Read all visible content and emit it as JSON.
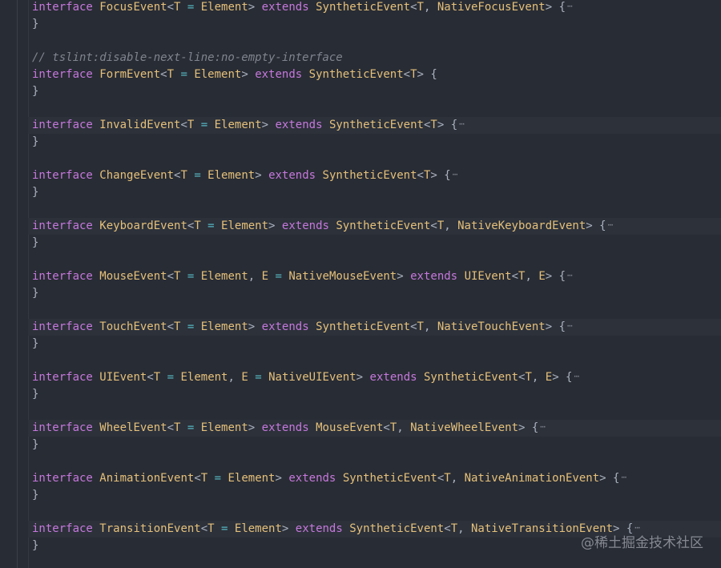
{
  "editor": {
    "comment": "// tslint:disable-next-line:no-empty-interface",
    "fold_marker": "⋯",
    "close_brace": "}",
    "lines": [
      {
        "kw": "interface",
        "name": "FocusEvent",
        "generic": "<T = Element>",
        "extends": "extends",
        "base": "SyntheticEvent<T, NativeFocusEvent>",
        "folded": true
      },
      {
        "kw": "interface",
        "name": "FormEvent",
        "generic": "<T = Element>",
        "extends": "extends",
        "base": "SyntheticEvent<T>",
        "folded": false
      },
      {
        "kw": "interface",
        "name": "InvalidEvent",
        "generic": "<T = Element>",
        "extends": "extends",
        "base": "SyntheticEvent<T>",
        "folded": true
      },
      {
        "kw": "interface",
        "name": "ChangeEvent",
        "generic": "<T = Element>",
        "extends": "extends",
        "base": "SyntheticEvent<T>",
        "folded": true
      },
      {
        "kw": "interface",
        "name": "KeyboardEvent",
        "generic": "<T = Element>",
        "extends": "extends",
        "base": "SyntheticEvent<T, NativeKeyboardEvent>",
        "folded": true
      },
      {
        "kw": "interface",
        "name": "MouseEvent",
        "generic": "<T = Element, E = NativeMouseEvent>",
        "extends": "extends",
        "base": "UIEvent<T, E>",
        "folded": true
      },
      {
        "kw": "interface",
        "name": "TouchEvent",
        "generic": "<T = Element>",
        "extends": "extends",
        "base": "SyntheticEvent<T, NativeTouchEvent>",
        "folded": true
      },
      {
        "kw": "interface",
        "name": "UIEvent",
        "generic": "<T = Element, E = NativeUIEvent>",
        "extends": "extends",
        "base": "SyntheticEvent<T, E>",
        "folded": true
      },
      {
        "kw": "interface",
        "name": "WheelEvent",
        "generic": "<T = Element>",
        "extends": "extends",
        "base": "MouseEvent<T, NativeWheelEvent>",
        "folded": true
      },
      {
        "kw": "interface",
        "name": "AnimationEvent",
        "generic": "<T = Element>",
        "extends": "extends",
        "base": "SyntheticEvent<T, NativeAnimationEvent>",
        "folded": true
      },
      {
        "kw": "interface",
        "name": "TransitionEvent",
        "generic": "<T = Element>",
        "extends": "extends",
        "base": "SyntheticEvent<T, NativeTransitionEvent>",
        "folded": true
      }
    ]
  },
  "watermark": "@稀土掘金技术社区",
  "colors": {
    "background": "#282c34",
    "keyword": "#c678dd",
    "type": "#e5c07b",
    "operator": "#56b6c2",
    "punctuation": "#abb2bf",
    "comment": "#7f848e"
  }
}
